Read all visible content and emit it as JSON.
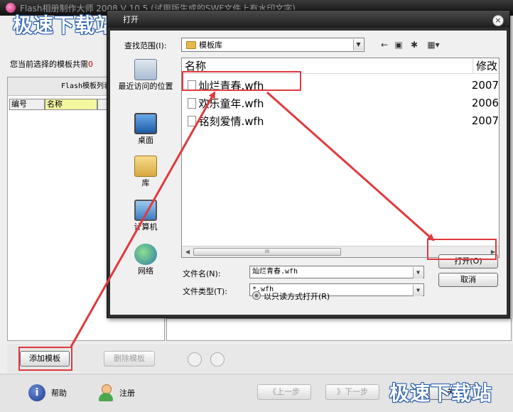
{
  "app": {
    "title": "Flash相册制作大师 2008 V 10.5 (试用版生成的SWF文件上有水印文字)",
    "template_count_label": "您当前选择的模板共需",
    "template_count_value": "0",
    "left_panel_title": "Flash模板列表",
    "columns": [
      "编号",
      "名称"
    ],
    "add_template": "添加模板",
    "delete_template": "删除模板",
    "prev_step": "《上一步",
    "next_step": "》下一步",
    "close": "关闭",
    "help": "帮助",
    "register": "注册",
    "accent_color": "#e0393e"
  },
  "watermark": "极速下载站",
  "dialog": {
    "title": "打开",
    "close_glyph": "×",
    "look_in_label": "查找范围(I):",
    "look_in_value": "模板库",
    "places": [
      "最近访问的位置",
      "桌面",
      "库",
      "计算机",
      "网络"
    ],
    "columns": [
      "名称",
      "修改"
    ],
    "files": [
      {
        "name": "灿烂青春.wfh",
        "date": "2007"
      },
      {
        "name": "欢乐童年.wfh",
        "date": "2006"
      },
      {
        "name": "铭刻爱情.wfh",
        "date": "2007"
      }
    ],
    "scroll_grip": "III",
    "filename_label": "文件名(N):",
    "filename_value": "灿烂青春.wfh",
    "filetype_label": "文件类型(T):",
    "filetype_value": "*.wfh",
    "readonly_label": "以只读方式打开(R)",
    "open_button": "打开(O)",
    "cancel_button": "取消"
  }
}
